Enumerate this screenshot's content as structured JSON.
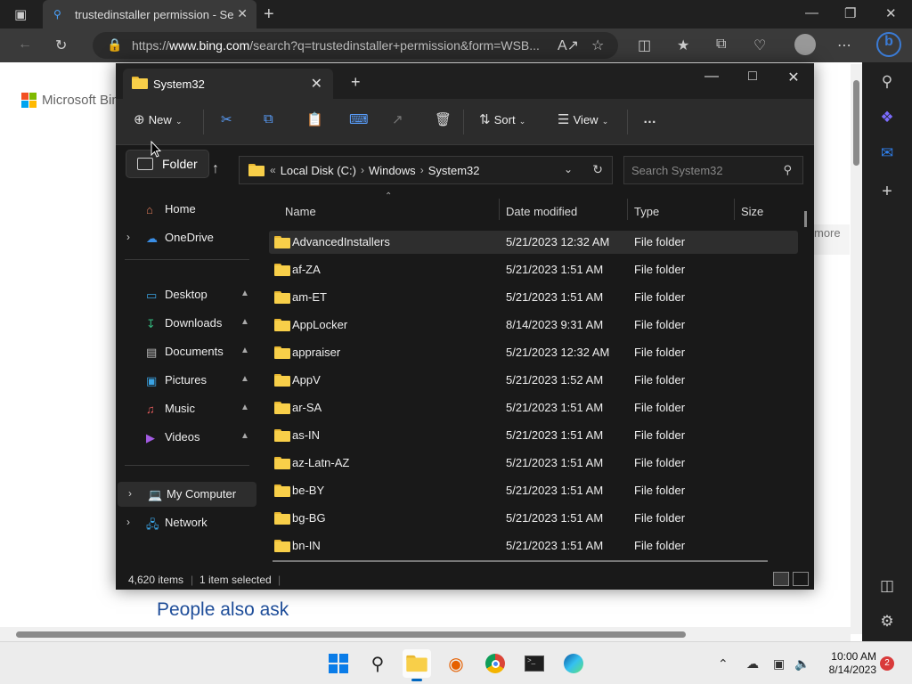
{
  "browser": {
    "tab_title": "trustedinstaller permission - Sear",
    "url_prefix": "https://",
    "url_host": "www.bing.com",
    "url_rest": "/search?q=trustedinstaller+permission&form=WSB...",
    "logo_text": "Microsoft Bing",
    "people_also_ask": "People also ask",
    "more_link": "more"
  },
  "explorer": {
    "tab_title": "System32",
    "toolbar": {
      "new_label": "New",
      "sort_label": "Sort",
      "view_label": "View",
      "more_label": "…"
    },
    "tooltip": "Folder",
    "path": {
      "overflow": "«",
      "segments": [
        "Local Disk (C:)",
        "Windows",
        "System32"
      ]
    },
    "search_placeholder": "Search System32",
    "nav": {
      "home": "Home",
      "onedrive": "OneDrive",
      "desktop": "Desktop",
      "downloads": "Downloads",
      "documents": "Documents",
      "pictures": "Pictures",
      "music": "Music",
      "videos": "Videos",
      "my_computer": "My Computer",
      "network": "Network"
    },
    "columns": {
      "name": "Name",
      "date": "Date modified",
      "type": "Type",
      "size": "Size"
    },
    "rows": [
      {
        "name": "AdvancedInstallers",
        "date": "5/21/2023 12:32 AM",
        "type": "File folder"
      },
      {
        "name": "af-ZA",
        "date": "5/21/2023 1:51 AM",
        "type": "File folder"
      },
      {
        "name": "am-ET",
        "date": "5/21/2023 1:51 AM",
        "type": "File folder"
      },
      {
        "name": "AppLocker",
        "date": "8/14/2023 9:31 AM",
        "type": "File folder"
      },
      {
        "name": "appraiser",
        "date": "5/21/2023 12:32 AM",
        "type": "File folder"
      },
      {
        "name": "AppV",
        "date": "5/21/2023 1:52 AM",
        "type": "File folder"
      },
      {
        "name": "ar-SA",
        "date": "5/21/2023 1:51 AM",
        "type": "File folder"
      },
      {
        "name": "as-IN",
        "date": "5/21/2023 1:51 AM",
        "type": "File folder"
      },
      {
        "name": "az-Latn-AZ",
        "date": "5/21/2023 1:51 AM",
        "type": "File folder"
      },
      {
        "name": "be-BY",
        "date": "5/21/2023 1:51 AM",
        "type": "File folder"
      },
      {
        "name": "bg-BG",
        "date": "5/21/2023 1:51 AM",
        "type": "File folder"
      },
      {
        "name": "bn-IN",
        "date": "5/21/2023 1:51 AM",
        "type": "File folder"
      }
    ],
    "status": {
      "items": "4,620 items",
      "selected": "1 item selected"
    }
  },
  "taskbar": {
    "time": "10:00 AM",
    "date": "8/14/2023",
    "notification_count": "2"
  },
  "colors": {
    "accent": "#0067c0",
    "folder": "#f8cf49",
    "explorer_bg": "#191919"
  }
}
